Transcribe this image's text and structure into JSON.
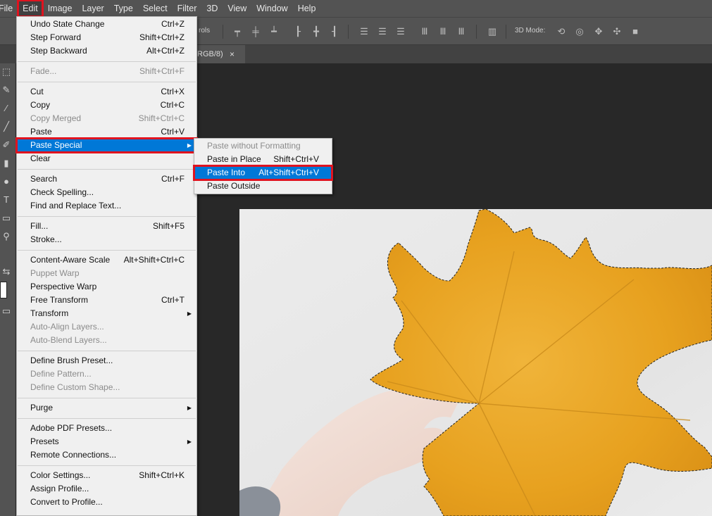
{
  "menubar": {
    "items": [
      "File",
      "Edit",
      "Image",
      "Layer",
      "Type",
      "Select",
      "Filter",
      "3D",
      "View",
      "Window",
      "Help"
    ],
    "active": "Edit"
  },
  "options_bar": {
    "controls_text": "rols",
    "mode_3d_text": "3D Mode:"
  },
  "document_tab": {
    "title_fragment": "RGB/8)",
    "close_glyph": "×"
  },
  "edit_menu": {
    "groups": [
      [
        {
          "label": "Undo State Change",
          "shortcut": "Ctrl+Z",
          "enabled": true
        },
        {
          "label": "Step Forward",
          "shortcut": "Shift+Ctrl+Z",
          "enabled": true
        },
        {
          "label": "Step Backward",
          "shortcut": "Alt+Ctrl+Z",
          "enabled": true
        }
      ],
      [
        {
          "label": "Fade...",
          "shortcut": "Shift+Ctrl+F",
          "enabled": false
        }
      ],
      [
        {
          "label": "Cut",
          "shortcut": "Ctrl+X",
          "enabled": true
        },
        {
          "label": "Copy",
          "shortcut": "Ctrl+C",
          "enabled": true
        },
        {
          "label": "Copy Merged",
          "shortcut": "Shift+Ctrl+C",
          "enabled": false
        },
        {
          "label": "Paste",
          "shortcut": "Ctrl+V",
          "enabled": true
        },
        {
          "label": "Paste Special",
          "shortcut": "",
          "enabled": true,
          "submenu": true,
          "highlighted": true
        },
        {
          "label": "Clear",
          "shortcut": "",
          "enabled": true
        }
      ],
      [
        {
          "label": "Search",
          "shortcut": "Ctrl+F",
          "enabled": true
        },
        {
          "label": "Check Spelling...",
          "shortcut": "",
          "enabled": true
        },
        {
          "label": "Find and Replace Text...",
          "shortcut": "",
          "enabled": true
        }
      ],
      [
        {
          "label": "Fill...",
          "shortcut": "Shift+F5",
          "enabled": true
        },
        {
          "label": "Stroke...",
          "shortcut": "",
          "enabled": true
        }
      ],
      [
        {
          "label": "Content-Aware Scale",
          "shortcut": "Alt+Shift+Ctrl+C",
          "enabled": true
        },
        {
          "label": "Puppet Warp",
          "shortcut": "",
          "enabled": false
        },
        {
          "label": "Perspective Warp",
          "shortcut": "",
          "enabled": true
        },
        {
          "label": "Free Transform",
          "shortcut": "Ctrl+T",
          "enabled": true
        },
        {
          "label": "Transform",
          "shortcut": "",
          "enabled": true,
          "submenu": true
        },
        {
          "label": "Auto-Align Layers...",
          "shortcut": "",
          "enabled": false
        },
        {
          "label": "Auto-Blend Layers...",
          "shortcut": "",
          "enabled": false
        }
      ],
      [
        {
          "label": "Define Brush Preset...",
          "shortcut": "",
          "enabled": true
        },
        {
          "label": "Define Pattern...",
          "shortcut": "",
          "enabled": false
        },
        {
          "label": "Define Custom Shape...",
          "shortcut": "",
          "enabled": false
        }
      ],
      [
        {
          "label": "Purge",
          "shortcut": "",
          "enabled": true,
          "submenu": true
        }
      ],
      [
        {
          "label": "Adobe PDF Presets...",
          "shortcut": "",
          "enabled": true
        },
        {
          "label": "Presets",
          "shortcut": "",
          "enabled": true,
          "submenu": true
        },
        {
          "label": "Remote Connections...",
          "shortcut": "",
          "enabled": true
        }
      ],
      [
        {
          "label": "Color Settings...",
          "shortcut": "Shift+Ctrl+K",
          "enabled": true
        },
        {
          "label": "Assign Profile...",
          "shortcut": "",
          "enabled": true
        },
        {
          "label": "Convert to Profile...",
          "shortcut": "",
          "enabled": true
        }
      ]
    ]
  },
  "paste_special_submenu": {
    "items": [
      {
        "label": "Paste without Formatting",
        "shortcut": "",
        "enabled": false
      },
      {
        "label": "Paste in Place",
        "shortcut": "Shift+Ctrl+V",
        "enabled": true
      },
      {
        "label": "Paste Into",
        "shortcut": "Alt+Shift+Ctrl+V",
        "enabled": true,
        "highlighted": true
      },
      {
        "label": "Paste Outside",
        "shortcut": "",
        "enabled": true
      }
    ]
  },
  "colors": {
    "highlight": "#0078d7",
    "callout": "#e0131f",
    "menu_bg": "#f0f0f0",
    "ui_panel": "#535353",
    "canvas_bg": "#282828",
    "leaf": "#e8a21e"
  }
}
